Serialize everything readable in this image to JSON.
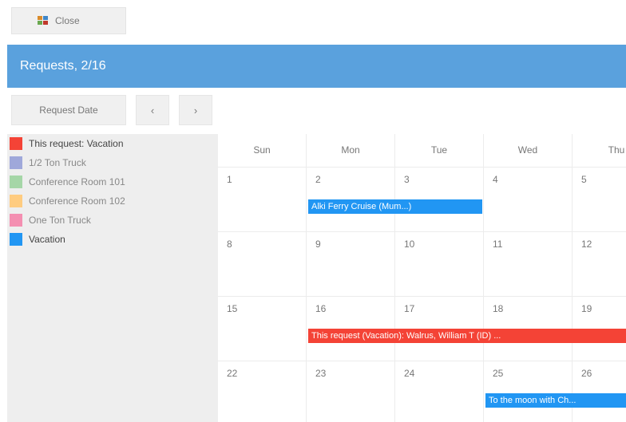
{
  "toolbar": {
    "close_label": "Close"
  },
  "title": "Requests, 2/16",
  "nav": {
    "date_button": "Request Date",
    "prev": "‹",
    "next": "›"
  },
  "legend": [
    {
      "label": "This request: Vacation",
      "color": "#f44336",
      "strong": true
    },
    {
      "label": "1/2 Ton Truck",
      "color": "#9fa8da",
      "strong": false
    },
    {
      "label": "Conference Room 101",
      "color": "#a5d6a7",
      "strong": false
    },
    {
      "label": "Conference Room 102",
      "color": "#ffcc80",
      "strong": false
    },
    {
      "label": "One Ton Truck",
      "color": "#f48fb1",
      "strong": false
    },
    {
      "label": "Vacation",
      "color": "#2196f3",
      "strong": true
    }
  ],
  "calendar": {
    "days": [
      "Sun",
      "Mon",
      "Tue",
      "Wed",
      "Thu"
    ],
    "weeks": [
      {
        "dates": [
          "1",
          "2",
          "3",
          "4",
          "5"
        ]
      },
      {
        "dates": [
          "8",
          "9",
          "10",
          "11",
          "12"
        ]
      },
      {
        "dates": [
          "15",
          "16",
          "17",
          "18",
          "19"
        ]
      },
      {
        "dates": [
          "22",
          "23",
          "24",
          "25",
          "26"
        ]
      }
    ],
    "events": [
      {
        "week": 0,
        "start": 1,
        "span": 2,
        "label": "Alki Ferry Cruise (Mum...)",
        "color": "#2196f3"
      },
      {
        "week": 2,
        "start": 1,
        "span": 4,
        "label": "This request (Vacation): Walrus, William T (ID) ...",
        "color": "#f44336"
      },
      {
        "week": 3,
        "start": 3,
        "span": 2,
        "label": "To the moon with Ch...",
        "color": "#2196f3"
      }
    ]
  }
}
